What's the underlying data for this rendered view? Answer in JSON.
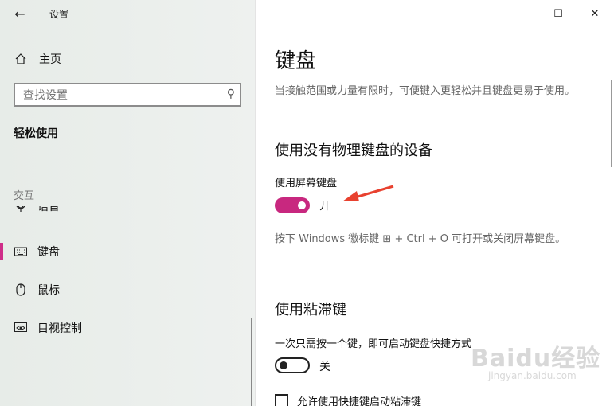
{
  "window": {
    "title": "设置",
    "back_icon": "arrow-left-icon",
    "controls": [
      "minimize-icon",
      "maximize-icon",
      "close-icon"
    ]
  },
  "sidebar": {
    "home_label": "主页",
    "search_placeholder": "查找设置",
    "section_title": "轻松使用",
    "group_label": "交互",
    "partial_item": {
      "label": "语音",
      "icon": "microphone-icon"
    },
    "items": [
      {
        "label": "键盘",
        "icon": "keyboard-icon",
        "active": true
      },
      {
        "label": "鼠标",
        "icon": "mouse-icon",
        "active": false
      },
      {
        "label": "目视控制",
        "icon": "eye-control-icon",
        "active": false
      }
    ]
  },
  "main": {
    "title": "键盘",
    "description": "当接触范围或力量有限时，可便键入更轻松并且键盘更易于使用。",
    "section1": {
      "heading": "使用没有物理键盘的设备",
      "setting_label": "使用屏幕键盘",
      "toggle_state": "开",
      "toggle_on": true,
      "hint": "按下 Windows 徽标键 ⊞ + Ctrl + O 可打开或关闭屏幕键盘。"
    },
    "section2": {
      "heading": "使用粘滞键",
      "setting_label": "一次只需按一个键，即可启动键盘快捷方式",
      "toggle_state": "关",
      "toggle_on": false,
      "checkbox_label": "允许使用快捷键启动粘滞键"
    }
  },
  "colors": {
    "accent": "#c8287f",
    "arrow": "#e8412f"
  },
  "watermark": {
    "main": "Baidu经验",
    "sub": "jingyan.baidu.com"
  }
}
